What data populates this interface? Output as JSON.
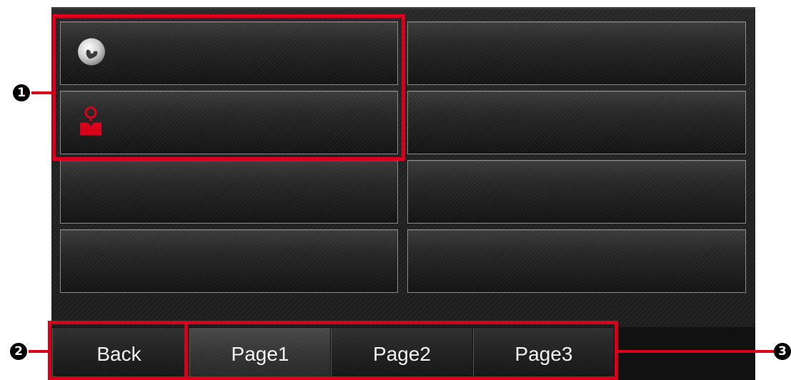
{
  "callouts": {
    "c1": "1",
    "c2": "2",
    "c3": "3"
  },
  "tiles": [
    {
      "icon": "phone-icon"
    },
    {
      "icon": ""
    },
    {
      "icon": "contact-person-icon"
    },
    {
      "icon": ""
    },
    {
      "icon": ""
    },
    {
      "icon": ""
    },
    {
      "icon": ""
    },
    {
      "icon": ""
    }
  ],
  "bottom_bar": {
    "back_label": "Back",
    "pages": [
      "Page1",
      "Page2",
      "Page3"
    ],
    "active_page": "Page1"
  },
  "colors": {
    "highlight": "#d9001b",
    "phone_icon": "#d6d6d6",
    "contact_icon": "#d9001b"
  }
}
